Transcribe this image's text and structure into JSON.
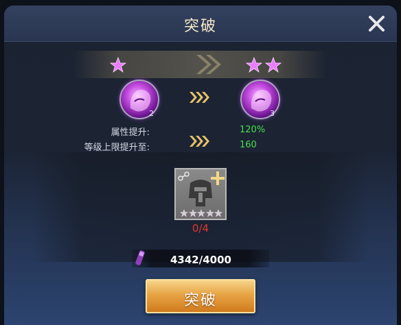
{
  "dialog": {
    "title": "突破"
  },
  "rank": {
    "from_stars": 1,
    "to_stars": 2,
    "star_color": "#e87cff"
  },
  "hero": {
    "current_level": "2",
    "next_level": "3",
    "icon": "purple-lion-icon"
  },
  "attributes": [
    {
      "label": "属性提升:",
      "value": "120%"
    },
    {
      "label": "等级上限提升至:",
      "value": "160"
    }
  ],
  "material": {
    "icon": "helmet-icon",
    "stars": 5,
    "count": "0/4",
    "add_icon": "plus-icon",
    "link_icon": "link-icon"
  },
  "resource": {
    "icon": "purple-scroll-icon",
    "amount": "4342/4000"
  },
  "action": {
    "label": "突破"
  },
  "colors": {
    "accent_gold": "#e7a445",
    "value_green": "#45e04c",
    "count_red": "#e6362d"
  }
}
